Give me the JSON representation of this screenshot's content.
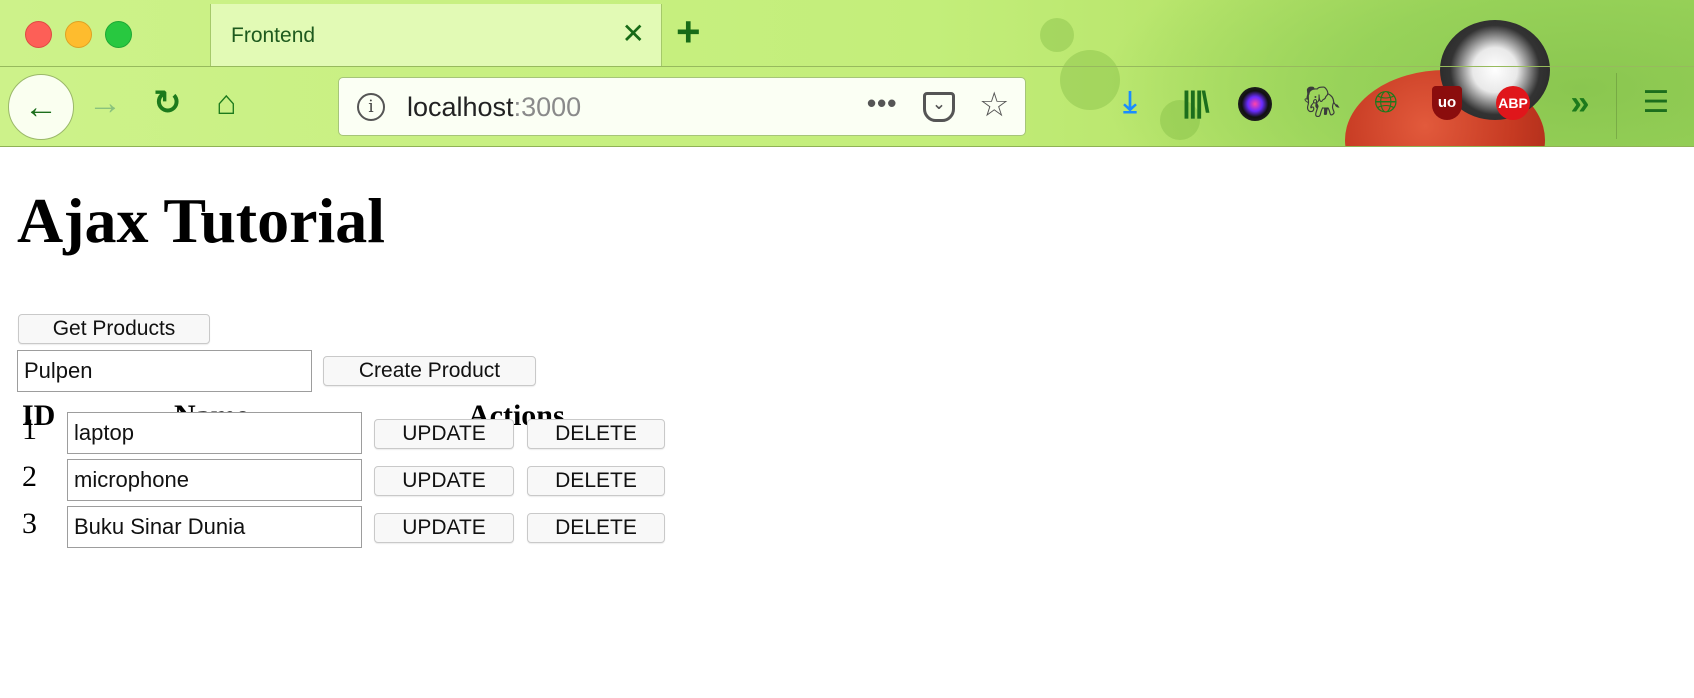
{
  "browser": {
    "tab_title": "Frontend",
    "tab_close_glyph": "✕",
    "new_tab_glyph": "+",
    "url_host": "localhost",
    "url_port": ":3000",
    "icons": [
      "back-arrow-icon",
      "forward-arrow-icon",
      "reload-icon",
      "home-icon",
      "site-info-icon",
      "page-actions-icon",
      "pocket-icon",
      "bookmark-star-icon",
      "download-icon",
      "library-icon",
      "camera-extension-icon",
      "evernote-icon",
      "globe-extension-icon",
      "ublock-icon",
      "adblock-plus-icon",
      "overflow-chevron-icon",
      "hamburger-menu-icon"
    ],
    "extension_labels": {
      "ublock": "uo",
      "abp": "ABP"
    }
  },
  "page": {
    "title": "Ajax Tutorial",
    "get_products_label": "Get Products",
    "new_product_value": "Pulpen",
    "create_product_label": "Create Product",
    "table": {
      "headers": {
        "id": "ID",
        "name": "Name",
        "actions": "Actions"
      },
      "rows": [
        {
          "id": "1",
          "name": "laptop",
          "update": "UPDATE",
          "delete": "DELETE"
        },
        {
          "id": "2",
          "name": "microphone",
          "update": "UPDATE",
          "delete": "DELETE"
        },
        {
          "id": "3",
          "name": "Buku Sinar Dunia",
          "update": "UPDATE",
          "delete": "DELETE"
        }
      ]
    }
  },
  "colors": {
    "chrome_green": "#c3ee7a",
    "accent_green": "#1c6e1c",
    "download_blue": "#1a8cff"
  }
}
